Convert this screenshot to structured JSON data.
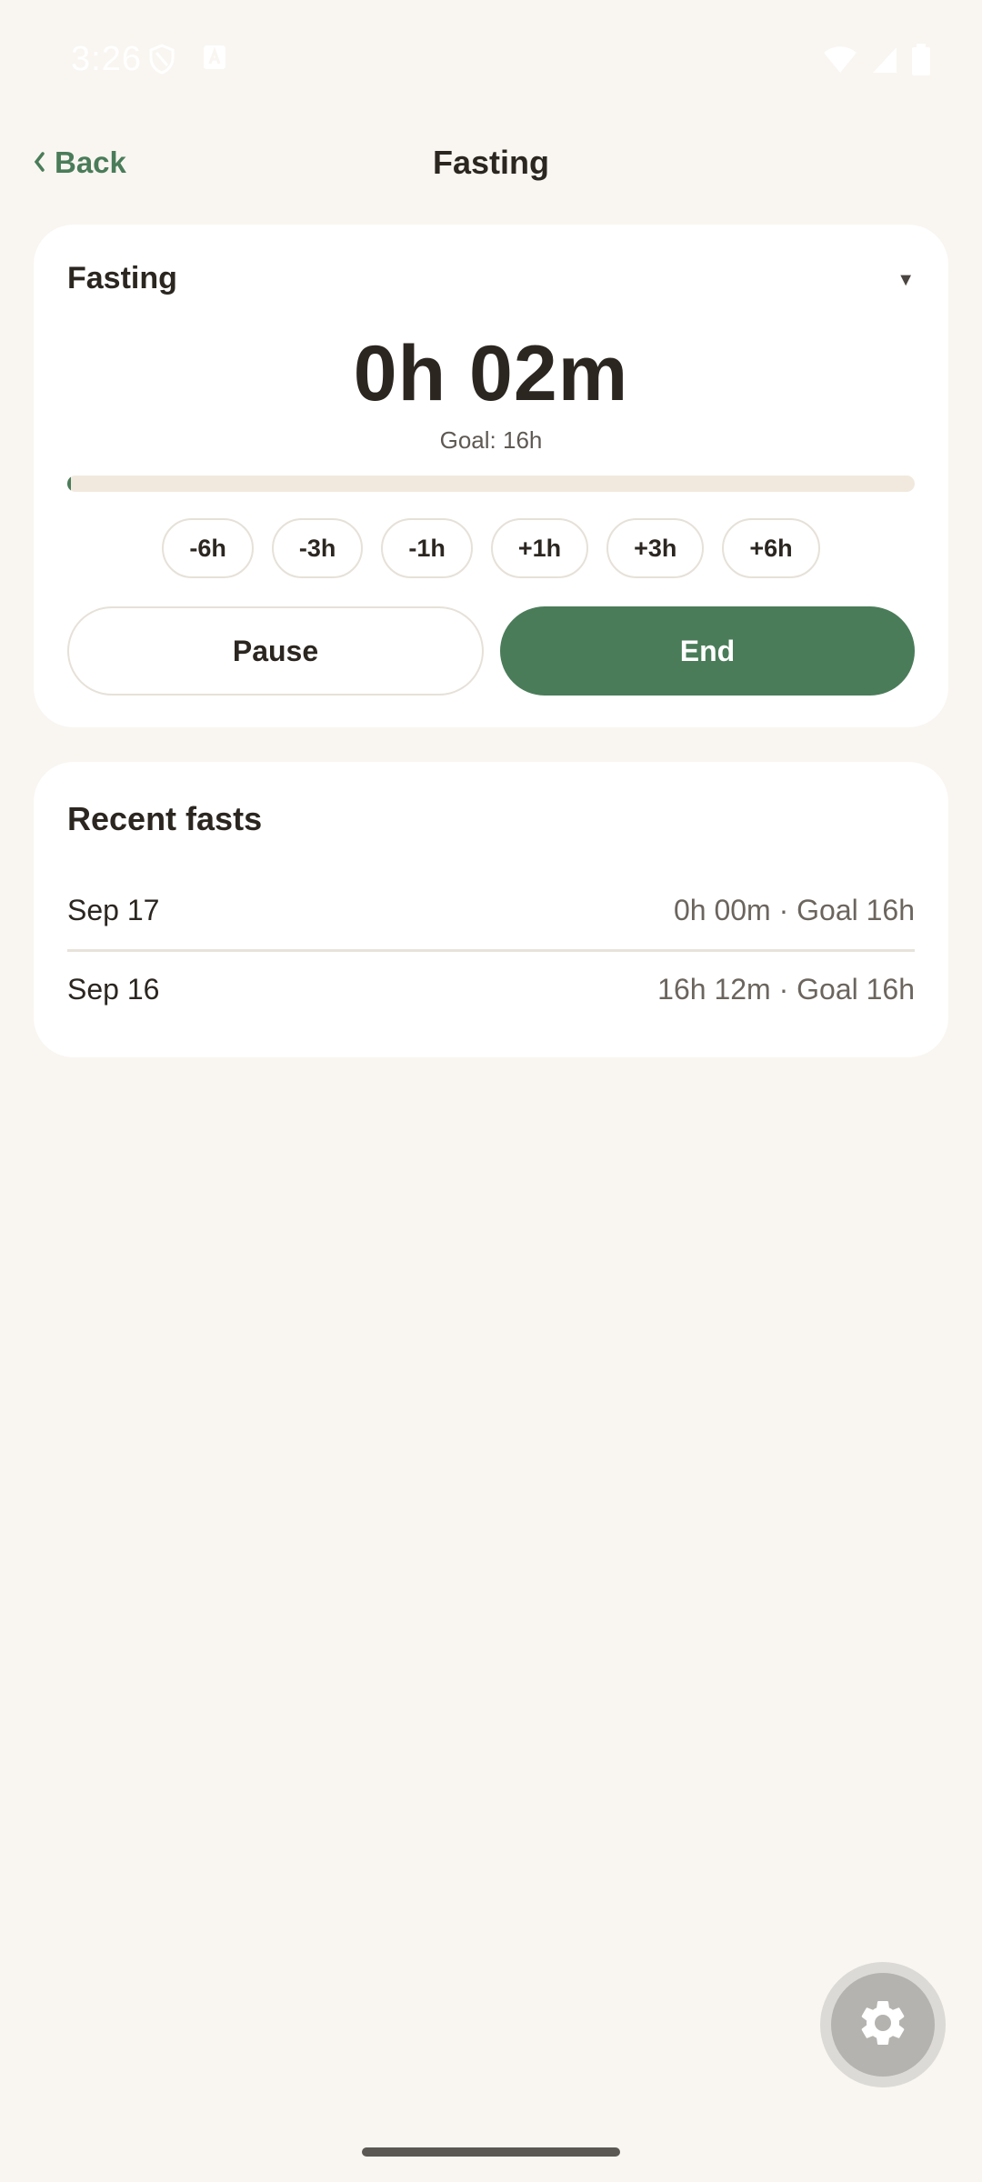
{
  "status_bar": {
    "time": "3:26",
    "icons": [
      "shield-icon",
      "a11y-icon",
      "wifi-icon",
      "signal-icon",
      "battery-icon"
    ]
  },
  "app_bar": {
    "back_label": "Back",
    "title": "Fasting"
  },
  "timer_card": {
    "mode_label": "Fasting",
    "elapsed": "0h 02m",
    "goal": "Goal: 16h",
    "progress_fraction": 0.002,
    "adjust_buttons": [
      "-6h",
      "-3h",
      "-1h",
      "+1h",
      "+3h",
      "+6h"
    ],
    "pause_label": "Pause",
    "end_label": "End"
  },
  "recent": {
    "title": "Recent fasts",
    "items": [
      {
        "date": "Sep 17",
        "detail": "0h 00m · Goal 16h"
      },
      {
        "date": "Sep 16",
        "detail": "16h 12m · Goal 16h"
      }
    ]
  },
  "colors": {
    "accent": "#4a7c59",
    "background": "#f9f6f1",
    "card": "#ffffff",
    "track": "#f1e9de"
  }
}
